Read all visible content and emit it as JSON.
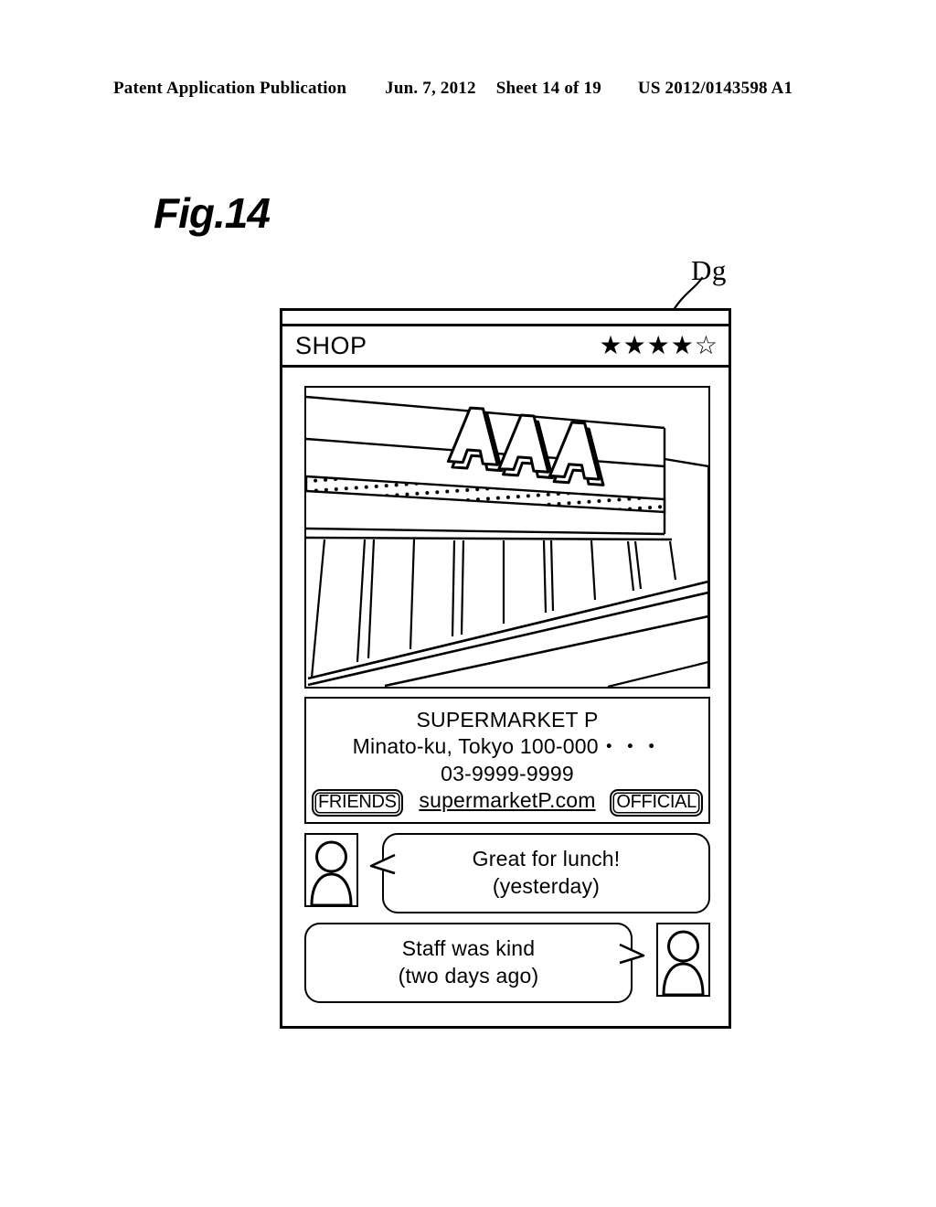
{
  "page_header": {
    "publication": "Patent Application Publication",
    "date": "Jun. 7, 2012",
    "sheet": "Sheet 14 of 19",
    "doc_number": "US 2012/0143598 A1"
  },
  "figure": {
    "label": "Fig.14",
    "callout": "Dg"
  },
  "device": {
    "title_bar": {
      "title": "SHOP",
      "rating_value": 4,
      "rating_max": 5,
      "star_filled": "★",
      "star_empty": "☆"
    },
    "photo": {
      "sign_text": "AAA",
      "alt": "storefront-illustration"
    },
    "info_panel": {
      "shop_name": "SUPERMARKET P",
      "address": "Minato-ku, Tokyo 100-000・・・",
      "phone": "03-9999-9999",
      "url": "supermarketP.com",
      "friends_tag": "FRIENDS",
      "official_tag": "OFFICIAL"
    },
    "comments": [
      {
        "side": "left",
        "text": "Great for lunch!",
        "time": "(yesterday)",
        "avatar": "person-avatar-icon"
      },
      {
        "side": "right",
        "text": "Staff was kind",
        "time": "(two days ago)",
        "avatar": "person-avatar-icon"
      }
    ]
  },
  "colors": {
    "ink": "#000000",
    "paper": "#ffffff"
  }
}
